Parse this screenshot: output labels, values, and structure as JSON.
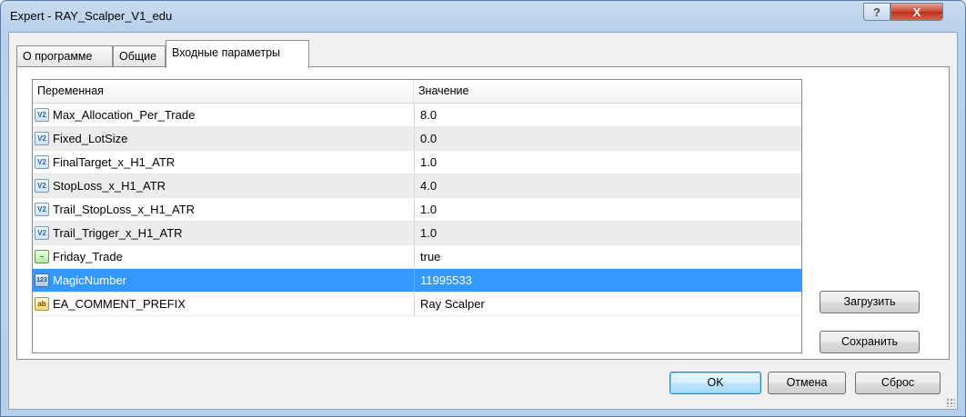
{
  "window": {
    "title": "Expert - RAY_Scalper_V1_edu",
    "help_label": "?",
    "close_label": "X"
  },
  "tabs": [
    {
      "label": "О программе"
    },
    {
      "label": "Общие"
    },
    {
      "label": "Входные параметры"
    }
  ],
  "grid": {
    "columns": {
      "variable": "Переменная",
      "value": "Значение"
    },
    "rows": [
      {
        "icon": "V2",
        "name": "Max_Allocation_Per_Trade",
        "value": "8.0"
      },
      {
        "icon": "V2",
        "name": "Fixed_LotSize",
        "value": "0.0"
      },
      {
        "icon": "V2",
        "name": "FinalTarget_x_H1_ATR",
        "value": "1.0"
      },
      {
        "icon": "V2",
        "name": "StopLoss_x_H1_ATR",
        "value": "4.0"
      },
      {
        "icon": "V2",
        "name": "Trail_StopLoss_x_H1_ATR",
        "value": "1.0"
      },
      {
        "icon": "V2",
        "name": "Trail_Trigger_x_H1_ATR",
        "value": "1.0"
      },
      {
        "icon": "~",
        "name": "Friday_Trade",
        "value": "true"
      },
      {
        "icon": "123",
        "name": "MagicNumber",
        "value": "11995533"
      },
      {
        "icon": "ab",
        "name": "EA_COMMENT_PREFIX",
        "value": "Ray Scalper"
      }
    ]
  },
  "side_buttons": {
    "load": "Загрузить",
    "save": "Сохранить"
  },
  "footer": {
    "ok": "OK",
    "cancel": "Отмена",
    "reset": "Сброс"
  }
}
